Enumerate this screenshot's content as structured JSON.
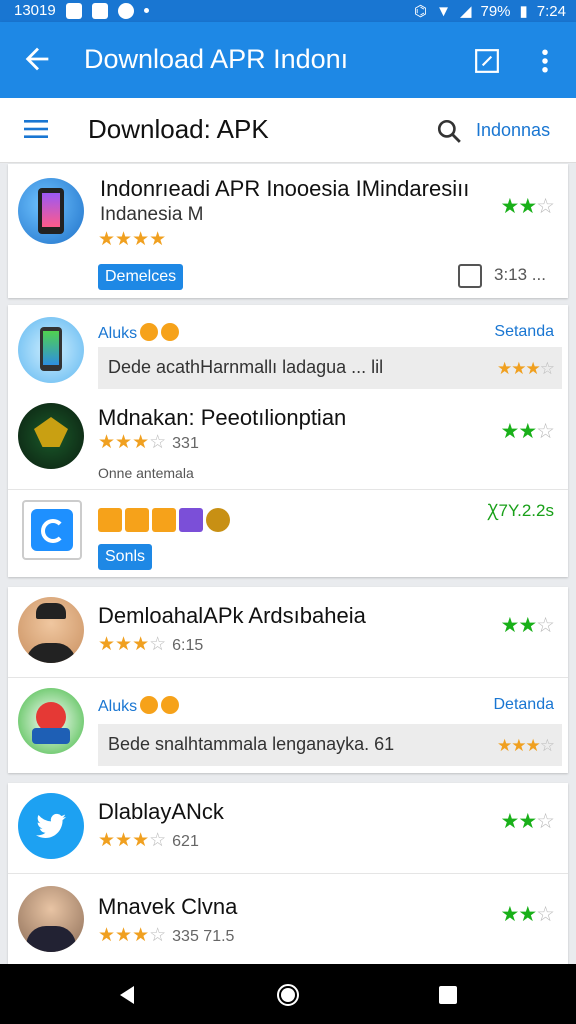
{
  "status_bar": {
    "time": "13019",
    "battery": "79%",
    "clock": "7:24"
  },
  "app_bar": {
    "title": "Download APR Indonı"
  },
  "toolbar": {
    "title": "Download: APK",
    "filter": "Indonnas"
  },
  "card1": {
    "name": "Indonrıeadi APR Inooesia IMindaresiıı",
    "subtitle": "Indanesia M",
    "rating": 4,
    "right_rating": 2,
    "badge": "Demelces",
    "meta": "3:13 ..."
  },
  "card2": {
    "row1": {
      "category": "Aluks",
      "category_right": "Setanda",
      "description": "Dede acathHarnmallı ladagua ... lil",
      "desc_rating": 3
    },
    "row2": {
      "name": "Mdnakan: Peeotılionptian",
      "rating": 3,
      "count": "331",
      "note": "Onne antemala",
      "right_rating": 2
    },
    "row3": {
      "right_text": "Ꭓ7Y.2.2s",
      "badge": "Sonls"
    }
  },
  "card3": {
    "row1": {
      "name": "DemloahalAPk Ardsıbaheia",
      "rating": 3,
      "count": "6:15",
      "right_rating": 2
    },
    "row2": {
      "category": "Aluks",
      "category_right": "Detanda",
      "description": "Bede snalhtammala lenganayka. 61",
      "desc_rating": 3
    }
  },
  "card4": {
    "row1": {
      "name": "DlablayANck",
      "rating": 3,
      "count": "621",
      "right_rating": 2
    },
    "row2": {
      "name": "Mnavek Clvna",
      "rating": 3,
      "count": "335   71.5",
      "right_rating": 2
    }
  },
  "colors": {
    "primary": "#1e88e5",
    "star": "#f0a020",
    "green_star": "#19b019"
  }
}
